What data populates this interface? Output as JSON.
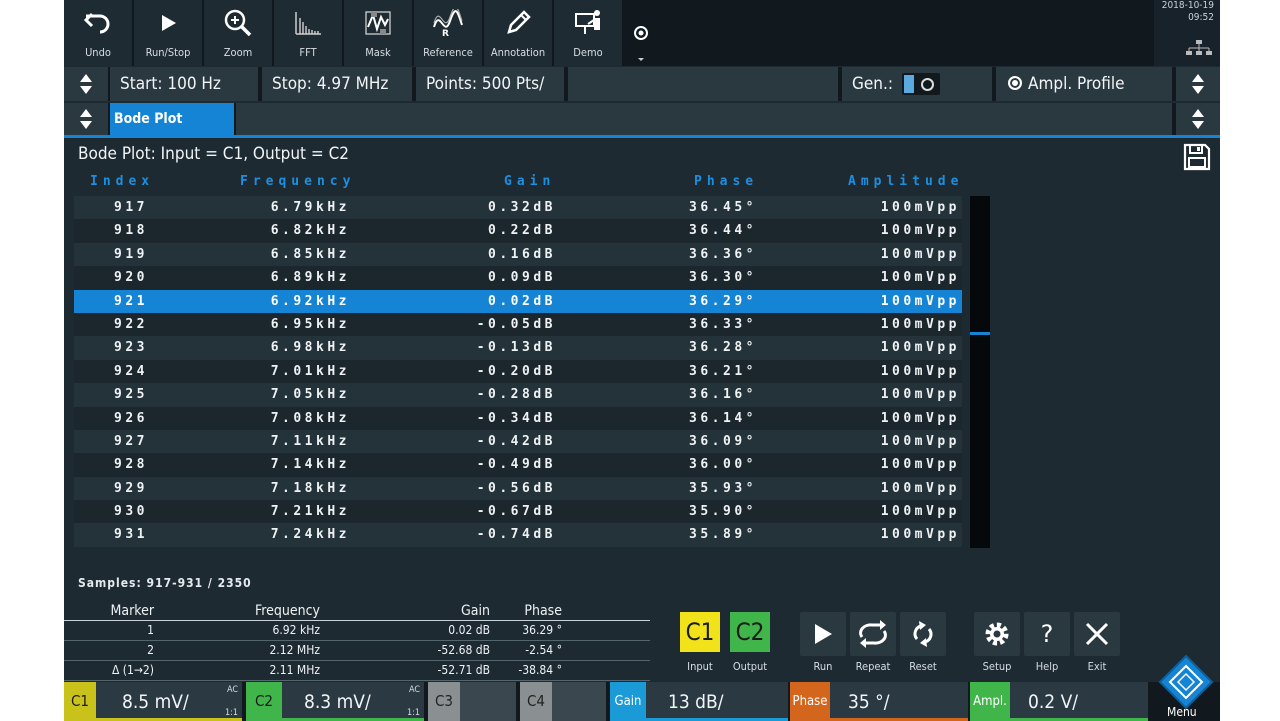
{
  "toolbar": {
    "buttons": [
      {
        "label": "Undo",
        "icon": "undo-icon"
      },
      {
        "label": "Run/Stop",
        "icon": "play-icon"
      },
      {
        "label": "Zoom",
        "icon": "zoom-icon"
      },
      {
        "label": "FFT",
        "icon": "fft-icon"
      },
      {
        "label": "Mask",
        "icon": "mask-icon"
      },
      {
        "label": "Reference",
        "icon": "reference-icon"
      },
      {
        "label": "Annotation",
        "icon": "pencil-icon"
      },
      {
        "label": "Demo",
        "icon": "demo-icon"
      }
    ],
    "date": "2018-10-19",
    "time": "09:52"
  },
  "sweep": {
    "start": "Start: 100 Hz",
    "stop": "Stop: 4.97 MHz",
    "points": "Points: 500 Pts/",
    "gen_label": "Gen.:",
    "ampl_profile": "Ampl. Profile"
  },
  "tabs": {
    "active": "Bode Plot"
  },
  "title": "Bode Plot: Input = C1, Output = C2",
  "table": {
    "headers": [
      "Index",
      "Frequency",
      "Gain",
      "Phase",
      "Amplitude"
    ],
    "selected_index": "921",
    "rows": [
      {
        "index": "917",
        "freq": "6.79kHz",
        "gain": "0.32dB",
        "phase": "36.45°",
        "amp": "100mVpp"
      },
      {
        "index": "918",
        "freq": "6.82kHz",
        "gain": "0.22dB",
        "phase": "36.44°",
        "amp": "100mVpp"
      },
      {
        "index": "919",
        "freq": "6.85kHz",
        "gain": "0.16dB",
        "phase": "36.36°",
        "amp": "100mVpp"
      },
      {
        "index": "920",
        "freq": "6.89kHz",
        "gain": "0.09dB",
        "phase": "36.30°",
        "amp": "100mVpp"
      },
      {
        "index": "921",
        "freq": "6.92kHz",
        "gain": "0.02dB",
        "phase": "36.29°",
        "amp": "100mVpp"
      },
      {
        "index": "922",
        "freq": "6.95kHz",
        "gain": "-0.05dB",
        "phase": "36.33°",
        "amp": "100mVpp"
      },
      {
        "index": "923",
        "freq": "6.98kHz",
        "gain": "-0.13dB",
        "phase": "36.28°",
        "amp": "100mVpp"
      },
      {
        "index": "924",
        "freq": "7.01kHz",
        "gain": "-0.20dB",
        "phase": "36.21°",
        "amp": "100mVpp"
      },
      {
        "index": "925",
        "freq": "7.05kHz",
        "gain": "-0.28dB",
        "phase": "36.16°",
        "amp": "100mVpp"
      },
      {
        "index": "926",
        "freq": "7.08kHz",
        "gain": "-0.34dB",
        "phase": "36.14°",
        "amp": "100mVpp"
      },
      {
        "index": "927",
        "freq": "7.11kHz",
        "gain": "-0.42dB",
        "phase": "36.09°",
        "amp": "100mVpp"
      },
      {
        "index": "928",
        "freq": "7.14kHz",
        "gain": "-0.49dB",
        "phase": "36.00°",
        "amp": "100mVpp"
      },
      {
        "index": "929",
        "freq": "7.18kHz",
        "gain": "-0.56dB",
        "phase": "35.93°",
        "amp": "100mVpp"
      },
      {
        "index": "930",
        "freq": "7.21kHz",
        "gain": "-0.67dB",
        "phase": "35.90°",
        "amp": "100mVpp"
      },
      {
        "index": "931",
        "freq": "7.24kHz",
        "gain": "-0.74dB",
        "phase": "35.89°",
        "amp": "100mVpp"
      }
    ]
  },
  "samples": "Samples: 917-931 / 2350",
  "markers": {
    "headers": [
      "Marker",
      "Frequency",
      "Gain",
      "Phase"
    ],
    "rows": [
      {
        "marker": "1",
        "freq": "6.92 kHz",
        "gain": "0.02 dB",
        "phase": "36.29 °"
      },
      {
        "marker": "2",
        "freq": "2.12 MHz",
        "gain": "-52.68 dB",
        "phase": "-2.54 °"
      },
      {
        "marker": "Δ (1→2)",
        "freq": "2.11 MHz",
        "gain": "-52.71 dB",
        "phase": "-38.84 °"
      }
    ]
  },
  "controls": {
    "input": {
      "label": "Input",
      "ch": "C1",
      "color": "#f2e21a"
    },
    "output": {
      "label": "Output",
      "ch": "C2",
      "color": "#3fb54a"
    },
    "run": "Run",
    "repeat": "Repeat",
    "reset": "Reset",
    "setup": "Setup",
    "help": "Help",
    "exit": "Exit"
  },
  "status": {
    "c1": {
      "tag": "C1",
      "value": "8.5 mV/",
      "coupling": "AC",
      "probe": "1:1",
      "color": "#c9c21a"
    },
    "c2": {
      "tag": "C2",
      "value": "8.3 mV/",
      "coupling": "AC",
      "probe": "1:1",
      "color": "#3fb54a"
    },
    "c3": {
      "tag": "C3"
    },
    "c4": {
      "tag": "C4"
    },
    "gain": {
      "tag": "Gain",
      "value": "13 dB/",
      "color": "#1a9ad6"
    },
    "phase": {
      "tag": "Phase",
      "value": "35 °/",
      "color": "#d4651c"
    },
    "ampl": {
      "tag": "Ampl.",
      "value": "0.2 V/",
      "color": "#3fb54a"
    },
    "menu": "Menu"
  }
}
